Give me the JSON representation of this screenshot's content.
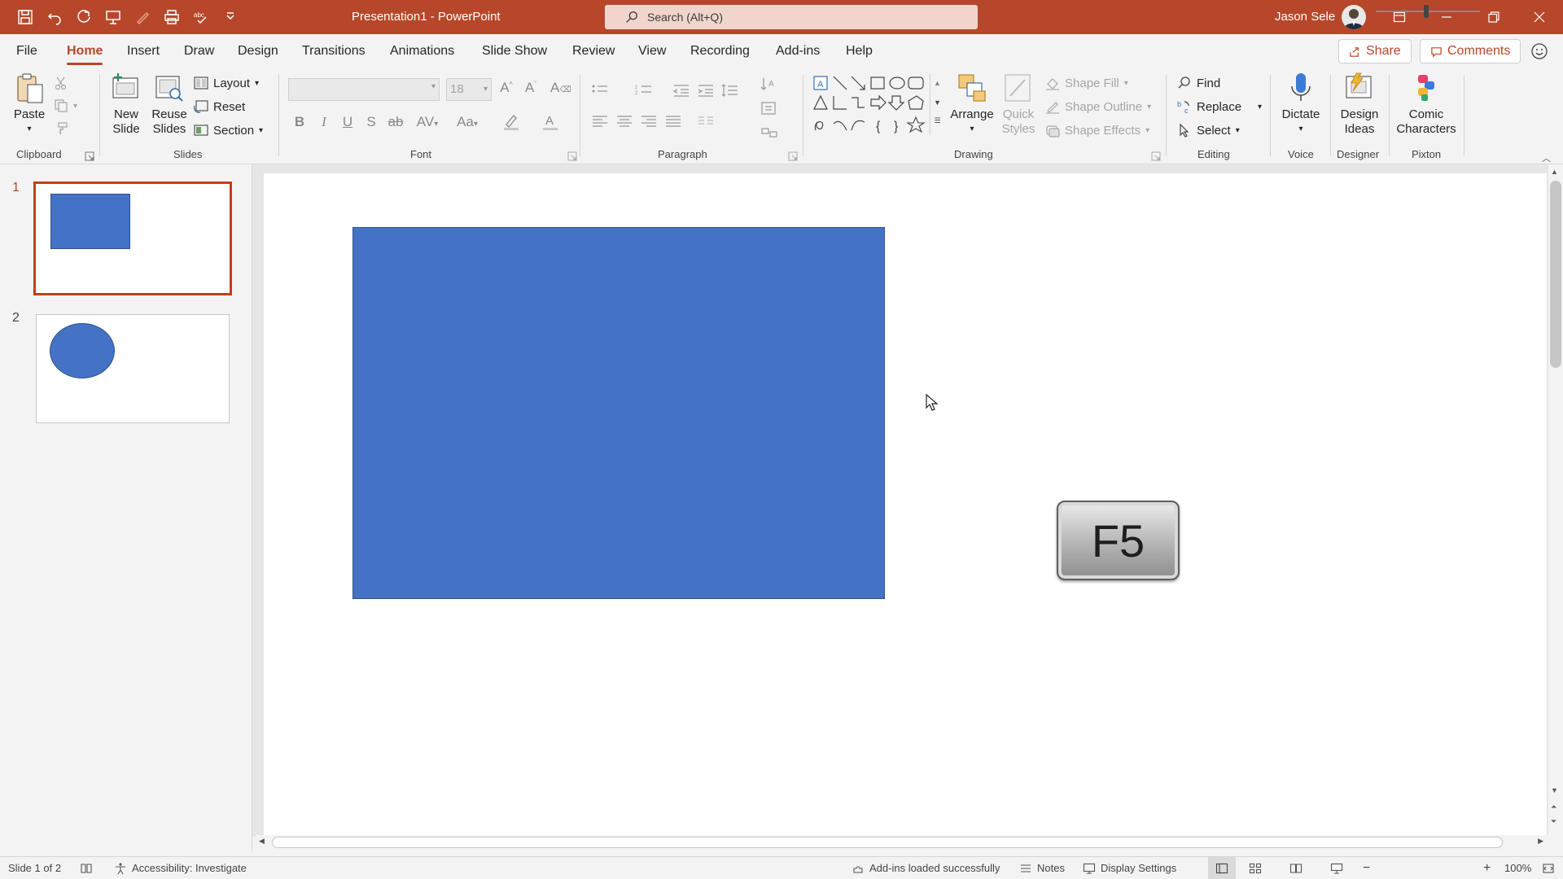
{
  "app": {
    "document_title": "Presentation1  -  PowerPoint",
    "search_placeholder": "Search (Alt+Q)",
    "user_name": "Jason Sele"
  },
  "tabs": [
    "File",
    "Home",
    "Insert",
    "Draw",
    "Design",
    "Transitions",
    "Animations",
    "Slide Show",
    "Review",
    "View",
    "Recording",
    "Add-ins",
    "Help"
  ],
  "active_tab": "Home",
  "header_buttons": {
    "share": "Share",
    "comments": "Comments"
  },
  "ribbon": {
    "clipboard": {
      "label": "Clipboard",
      "paste": "Paste"
    },
    "slides": {
      "label": "Slides",
      "new_slide_1": "New",
      "new_slide_2": "Slide",
      "reuse_1": "Reuse",
      "reuse_2": "Slides",
      "layout": "Layout",
      "reset": "Reset",
      "section": "Section"
    },
    "font": {
      "label": "Font",
      "size": "18"
    },
    "paragraph": {
      "label": "Paragraph"
    },
    "drawing": {
      "label": "Drawing",
      "arrange": "Arrange",
      "quick_1": "Quick",
      "quick_2": "Styles",
      "shape_fill": "Shape Fill",
      "shape_outline": "Shape Outline",
      "shape_effects": "Shape Effects"
    },
    "editing": {
      "label": "Editing",
      "find": "Find",
      "replace": "Replace",
      "select": "Select"
    },
    "voice": {
      "label": "Voice",
      "dictate": "Dictate"
    },
    "designer": {
      "label": "Designer",
      "design_1": "Design",
      "design_2": "Ideas"
    },
    "pixton": {
      "label": "Pixton",
      "comic_1": "Comic",
      "comic_2": "Characters"
    }
  },
  "thumbnails": [
    {
      "number": "1",
      "selected": true,
      "shape": "rectangle"
    },
    {
      "number": "2",
      "selected": false,
      "shape": "ellipse"
    }
  ],
  "slide": {
    "key_label": "F5",
    "rect_color": "#4472c4"
  },
  "status": {
    "slide_count": "Slide 1 of 2",
    "accessibility": "Accessibility: Investigate",
    "addins": "Add-ins loaded successfully",
    "notes": "Notes",
    "display_settings": "Display Settings",
    "zoom": "100%"
  },
  "colors": {
    "accent": "#b7472a",
    "shape_blue": "#4472c4"
  }
}
